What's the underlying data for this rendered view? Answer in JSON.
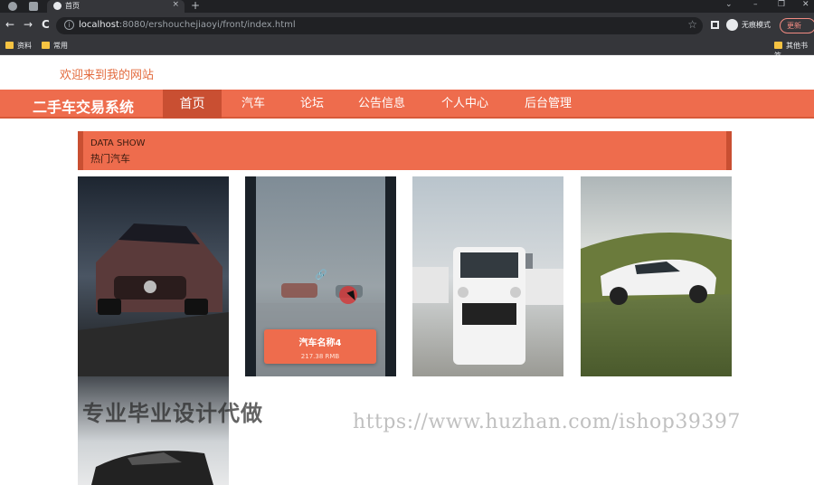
{
  "browser": {
    "tab_title": "首页",
    "tab_close": "×",
    "new_tab": "+",
    "back_glyph": "←",
    "forward_glyph": "→",
    "reload_glyph": "C",
    "info_glyph": "i",
    "star_glyph": "☆",
    "window_controls": [
      "⌄",
      "–",
      "❐",
      "✕"
    ],
    "url_host": "localhost",
    "url_path": ":8080/ershouchejiaoyi/front/index.html",
    "incognito_label": "无痕模式",
    "update_label": "更新",
    "bookmarks": [
      "资料",
      "常用",
      "其他书签"
    ]
  },
  "site": {
    "welcome": "欢迎来到我的网站",
    "brand": "二手车交易系统",
    "nav": [
      "首页",
      "汽车",
      "论坛",
      "公告信息",
      "个人中心",
      "后台管理"
    ],
    "active_nav_index": 0
  },
  "section": {
    "title_en": "DATA SHOW",
    "title_cn": "热门汽车"
  },
  "hover_card": {
    "name": "汽车名称4",
    "price": "217.38 RMB"
  },
  "watermarks": {
    "cn": "专业毕业设计代做",
    "url": "https://www.huzhan.com/ishop39397"
  },
  "colors": {
    "accent": "#ee6c4d",
    "accent_dark": "#c94f32",
    "welcome_text": "#e36c3f"
  },
  "icons": {
    "link": "link-icon",
    "cursor": "mouse-cursor-icon"
  }
}
